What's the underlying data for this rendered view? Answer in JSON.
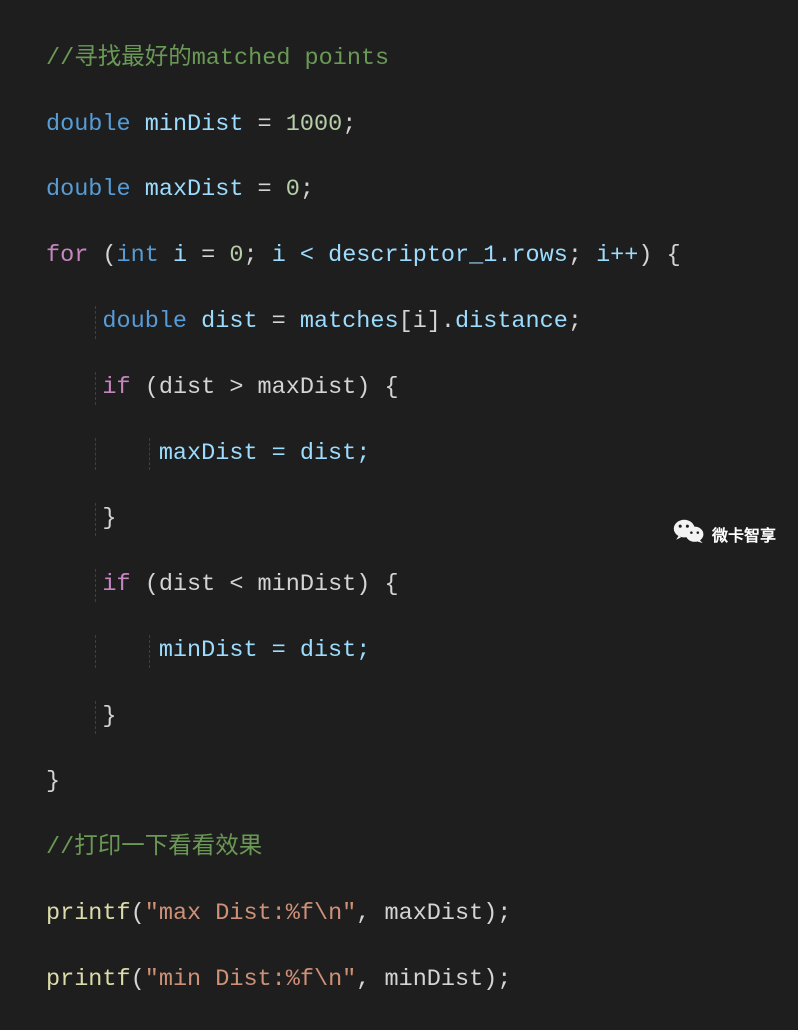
{
  "code": {
    "l1_comment": "//寻找最好的matched points",
    "l2_type": "double",
    "l2_id": "minDist",
    "l2_eq": " = ",
    "l2_num": "1000",
    "l2_semi": ";",
    "l3_type": "double",
    "l3_id": "maxDist",
    "l3_eq": " = ",
    "l3_num": "0",
    "l3_semi": ";",
    "l4_for": "for",
    "l4_op1": " (",
    "l4_int": "int",
    "l4_i": " i",
    "l4_eq": " = ",
    "l4_zero": "0",
    "l4_semi1": ";",
    "l4_cond": " i < descriptor_1.",
    "l4_rows": "rows",
    "l4_semi2": ";",
    "l4_inc": " i++",
    "l4_cp": ") {",
    "l5_type": "double",
    "l5_id": " dist",
    "l5_eq": " = ",
    "l5_matches": "matches",
    "l5_br": "[i].",
    "l5_dist": "distance",
    "l5_semi": ";",
    "l6_if": "if",
    "l6_op": " (dist > maxDist) {",
    "l7_body": "maxDist = dist;",
    "l8_close": "}",
    "l9_if": "if",
    "l9_op": " (dist < minDist) {",
    "l10_body": "minDist = dist;",
    "l11_close": "}",
    "l12_close": "}",
    "l13_comment": "//打印一下看看效果",
    "l14_fn": "printf",
    "l14_op": "(",
    "l14_str": "\"max Dist:%f\\n\"",
    "l14_rest": ", maxDist);",
    "l15_fn": "printf",
    "l15_op": "(",
    "l15_str": "\"min Dist:%f\\n\"",
    "l15_rest": ", minDist);"
  },
  "watermark": "微卡智享"
}
